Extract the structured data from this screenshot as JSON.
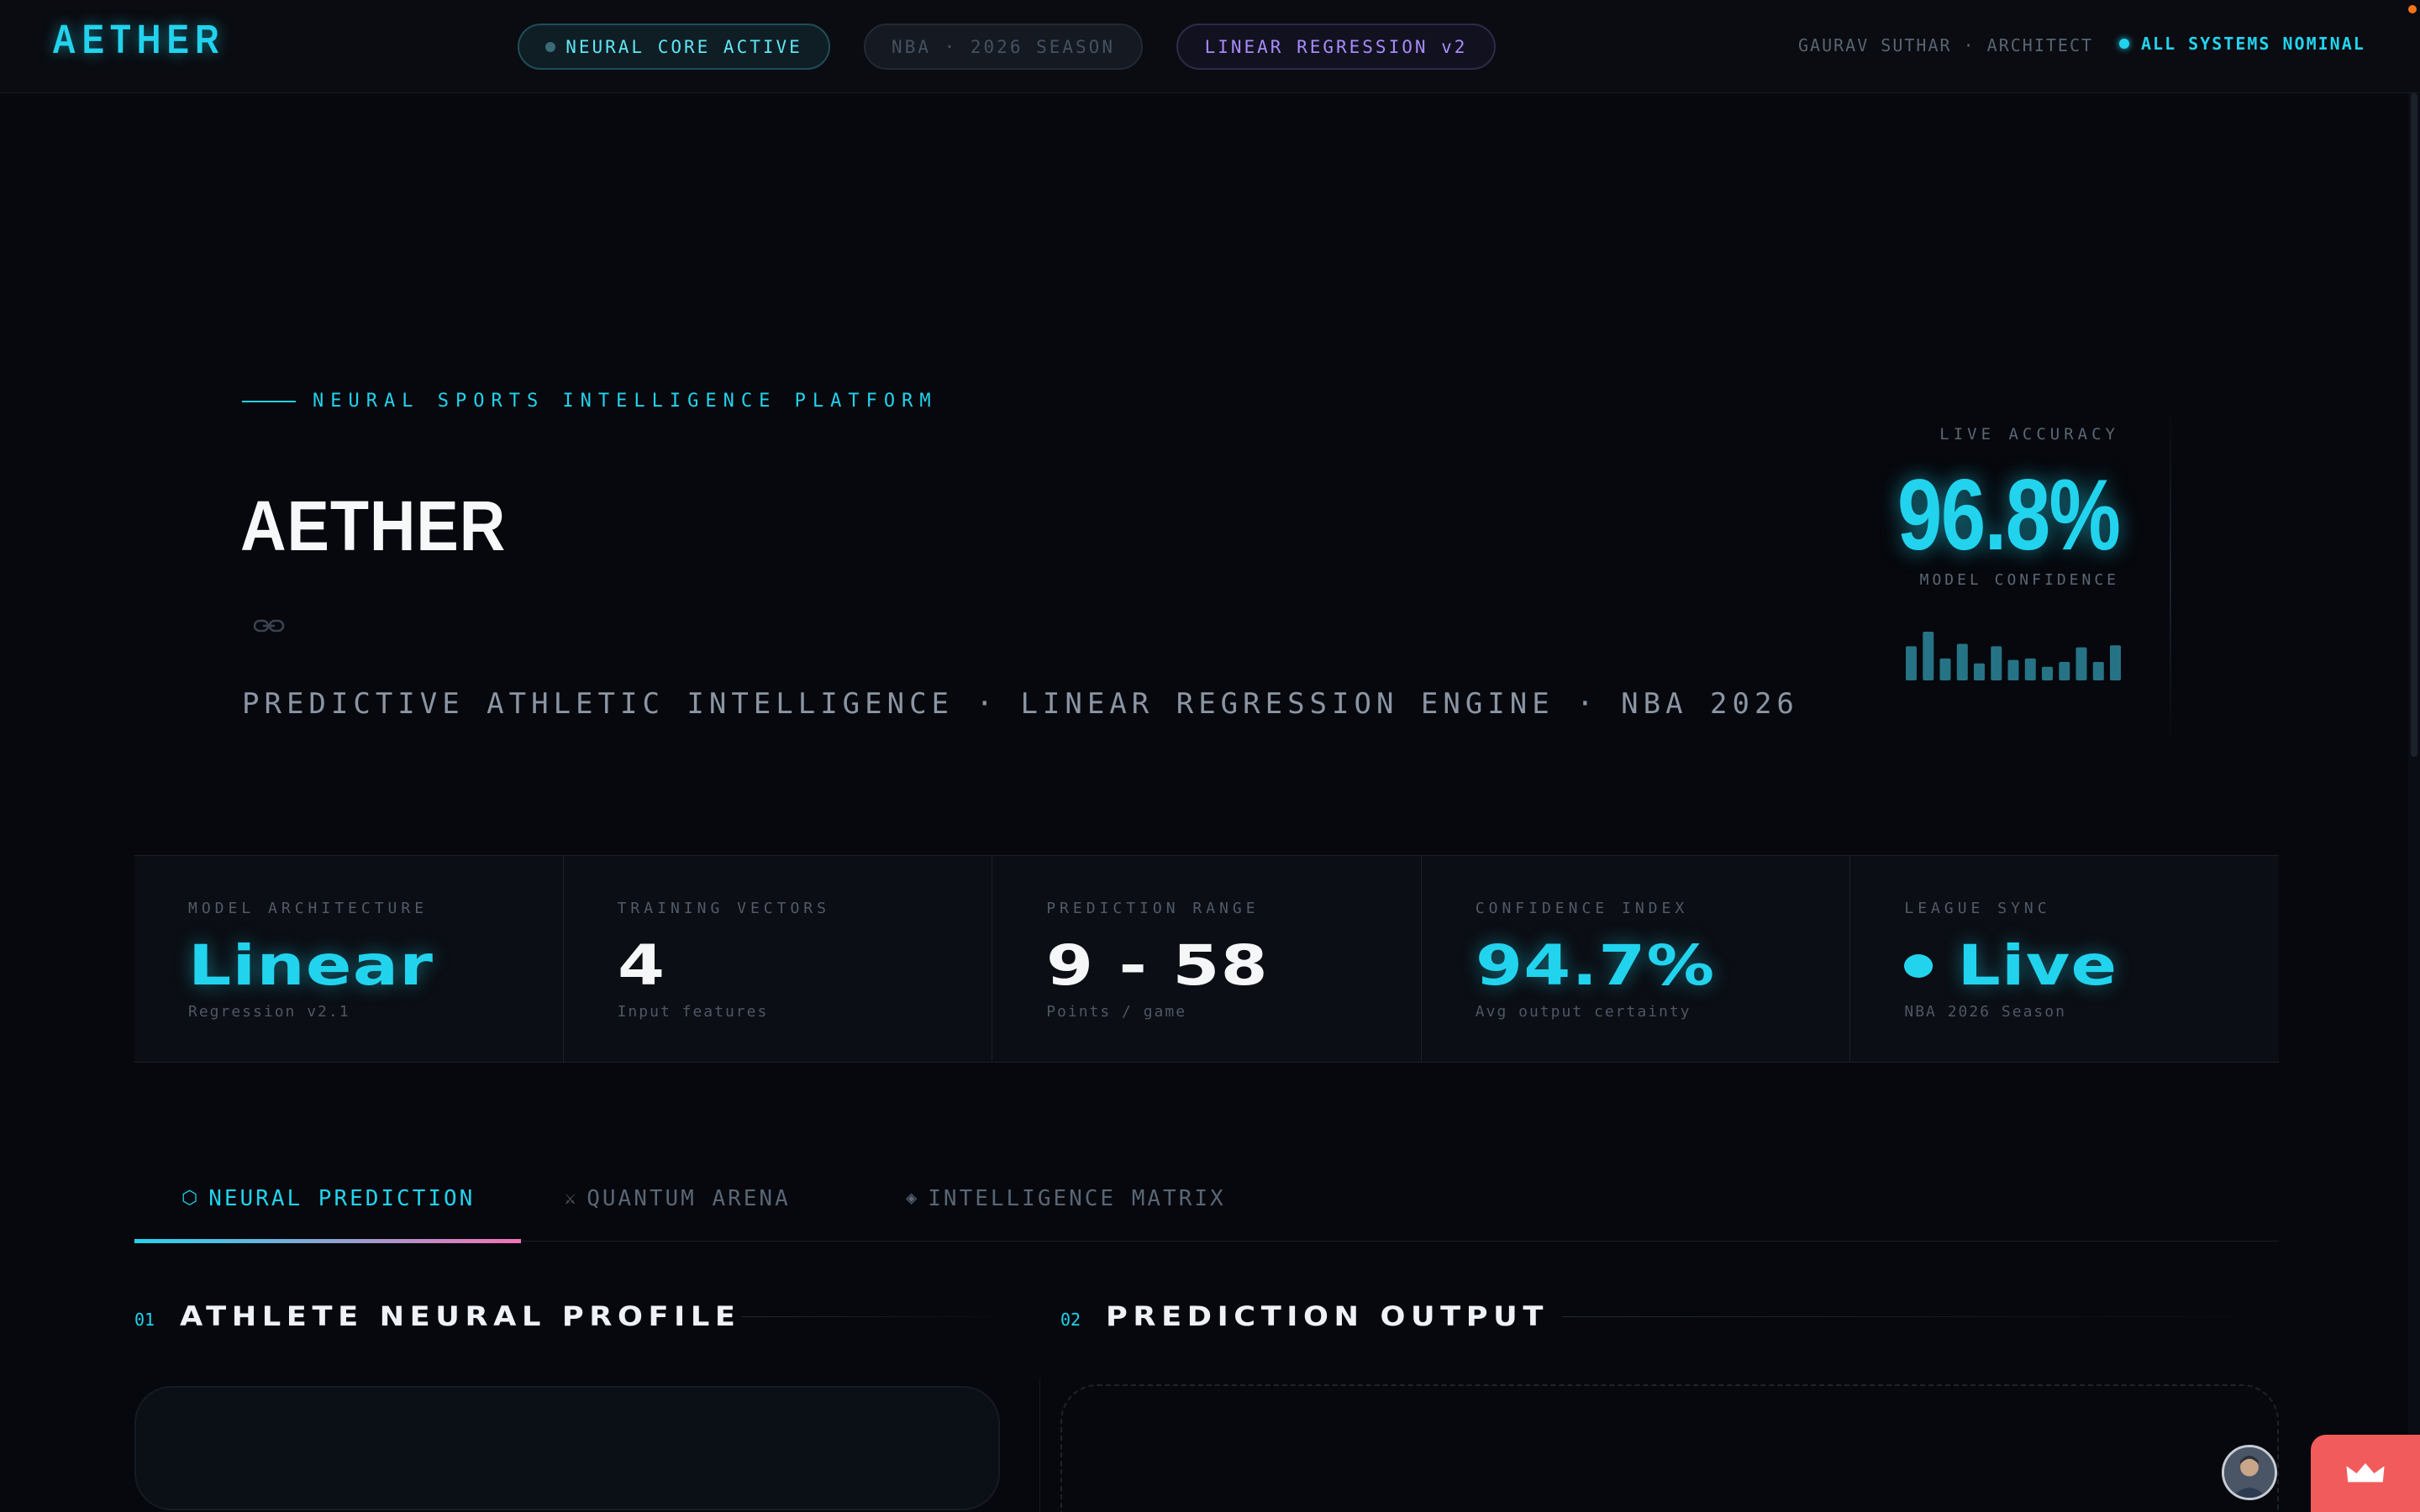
{
  "header": {
    "brand": "AETHER",
    "pills": {
      "core": "NEURAL CORE ACTIVE",
      "season": "NBA · 2026 SEASON",
      "model": "LINEAR REGRESSION v2"
    },
    "architect": "GAURAV SUTHAR · ARCHITECT",
    "status": "ALL SYSTEMS NOMINAL"
  },
  "hero": {
    "eyebrow": "NEURAL SPORTS INTELLIGENCE PLATFORM",
    "title": "AETHER",
    "subtitle": "PREDICTIVE ATHLETIC INTELLIGENCE · LINEAR REGRESSION ENGINE · NBA 2026"
  },
  "accuracy": {
    "label": "LIVE ACCURACY",
    "value": "96.8%",
    "caption": "MODEL CONFIDENCE",
    "bars": [
      0.7,
      1.0,
      0.45,
      0.75,
      0.35,
      0.7,
      0.42,
      0.45,
      0.28,
      0.38,
      0.68,
      0.38,
      0.72
    ]
  },
  "stats": [
    {
      "label": "MODEL ARCHITECTURE",
      "value": "Linear",
      "sub": "Regression v2.1",
      "accent": "cyan"
    },
    {
      "label": "TRAINING VECTORS",
      "value": "4",
      "sub": "Input features",
      "accent": "white"
    },
    {
      "label": "PREDICTION RANGE",
      "value": "9 - 58",
      "sub": "Points / game",
      "accent": "white"
    },
    {
      "label": "CONFIDENCE INDEX",
      "value": "94.7%",
      "sub": "Avg output certainty",
      "accent": "cyan"
    },
    {
      "label": "LEAGUE SYNC",
      "value": "Live",
      "sub": "NBA 2026 Season",
      "accent": "cyan"
    }
  ],
  "tabs": [
    {
      "icon": "hexagon-icon",
      "label": "NEURAL PREDICTION",
      "active": true
    },
    {
      "icon": "crossed-swords-icon",
      "label": "QUANTUM ARENA",
      "active": false
    },
    {
      "icon": "diamond-icon",
      "label": "INTELLIGENCE MATRIX",
      "active": false
    }
  ],
  "sections": {
    "profile": {
      "num": "01",
      "title": "ATHLETE NEURAL PROFILE"
    },
    "output": {
      "num": "02",
      "title": "PREDICTION OUTPUT"
    }
  },
  "colors": {
    "accent": "#22d3ee",
    "violet": "#a78bfa",
    "background": "#06080d",
    "crown_button": "#f25b5b"
  }
}
